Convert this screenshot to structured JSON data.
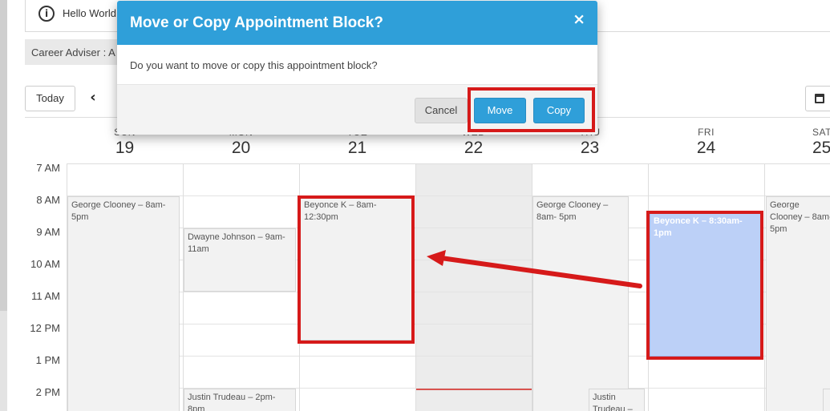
{
  "notice": {
    "text": "Hello World",
    "icon": "info-icon"
  },
  "adviser": {
    "label": "Career Adviser : A"
  },
  "toolbar": {
    "today_label": "Today",
    "prev_icon": "chevron-left-icon",
    "calendar_icon": "calendar-icon",
    "prev_glyph": "‹"
  },
  "calendar": {
    "days": [
      {
        "name": "SUN",
        "num": "19"
      },
      {
        "name": "MON",
        "num": "20"
      },
      {
        "name": "TUE",
        "num": "21"
      },
      {
        "name": "WED",
        "num": "22"
      },
      {
        "name": "THU",
        "num": "23"
      },
      {
        "name": "FRI",
        "num": "24"
      },
      {
        "name": "SAT",
        "num": "25"
      }
    ],
    "times": [
      "7 AM",
      "8 AM",
      "9 AM",
      "10 AM",
      "11 AM",
      "12 PM",
      "1 PM",
      "2 PM"
    ],
    "events": {
      "sun_george": "George Clooney – 8am-5pm",
      "mon_dwayne": "Dwayne Johnson – 9am-11am",
      "mon_justin": "Justin Trudeau – 2pm-8pm",
      "tue_beyonce": "Beyonce K – 8am-12:30pm",
      "thu_george": "George Clooney – 8am- 5pm",
      "thu_justin": "Justin Trudeau – ",
      "fri_beyonce": "Beyonce K – 8:30am- 1pm",
      "sat_george": "George Clooney – 8am- 5pm"
    }
  },
  "modal": {
    "title": "Move or Copy Appointment Block?",
    "close_glyph": "×",
    "body": "Do you want to move or copy this appointment block?",
    "cancel_label": "Cancel",
    "move_label": "Move",
    "copy_label": "Copy"
  },
  "colors": {
    "accent": "#2f9fd9",
    "highlight": "#d61a1a",
    "selected_event": "#bcd0f7"
  }
}
